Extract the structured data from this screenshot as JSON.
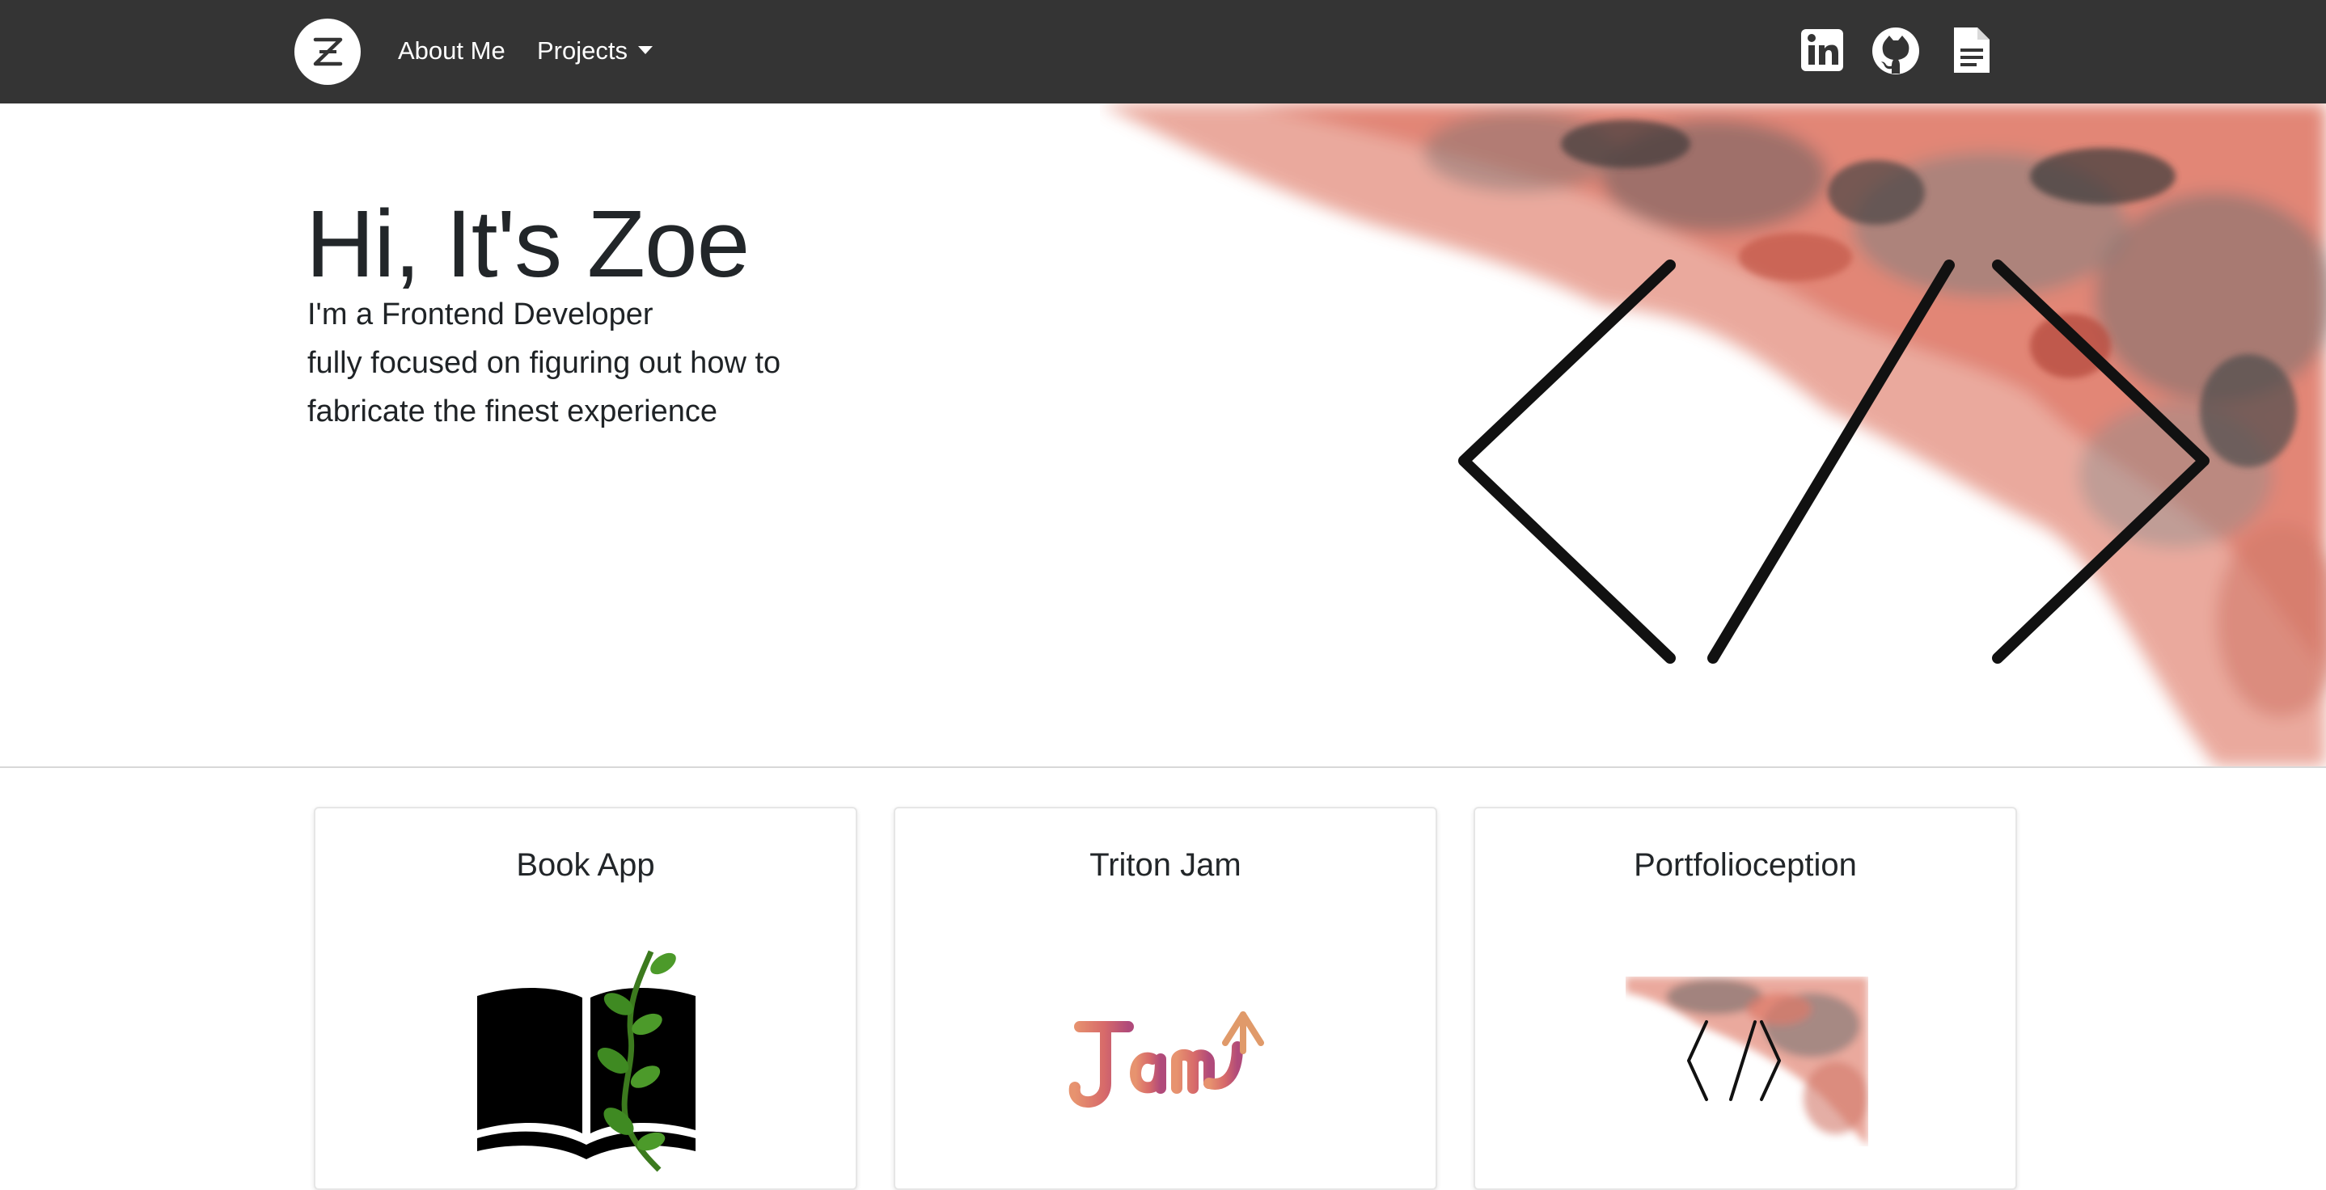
{
  "navbar": {
    "brand_letter": "Z",
    "links": [
      {
        "label": "About Me"
      },
      {
        "label": "Projects"
      }
    ],
    "social_icons": [
      "linkedin-icon",
      "github-icon",
      "resume-document-icon"
    ],
    "background_color": "#343434"
  },
  "hero": {
    "title": "Hi, It's Zoe",
    "lines": [
      "I'm a Frontend Developer",
      "fully focused on figuring out how to",
      "fabricate the finest experience"
    ],
    "art_icon": "code-brackets-icon",
    "accent_color": "#d9634f"
  },
  "projects": [
    {
      "title": "Book App",
      "image": "book-with-vine-icon"
    },
    {
      "title": "Triton Jam",
      "image": "jam-logo"
    },
    {
      "title": "Portfolioception",
      "image": "portfolio-thumbnail"
    }
  ]
}
